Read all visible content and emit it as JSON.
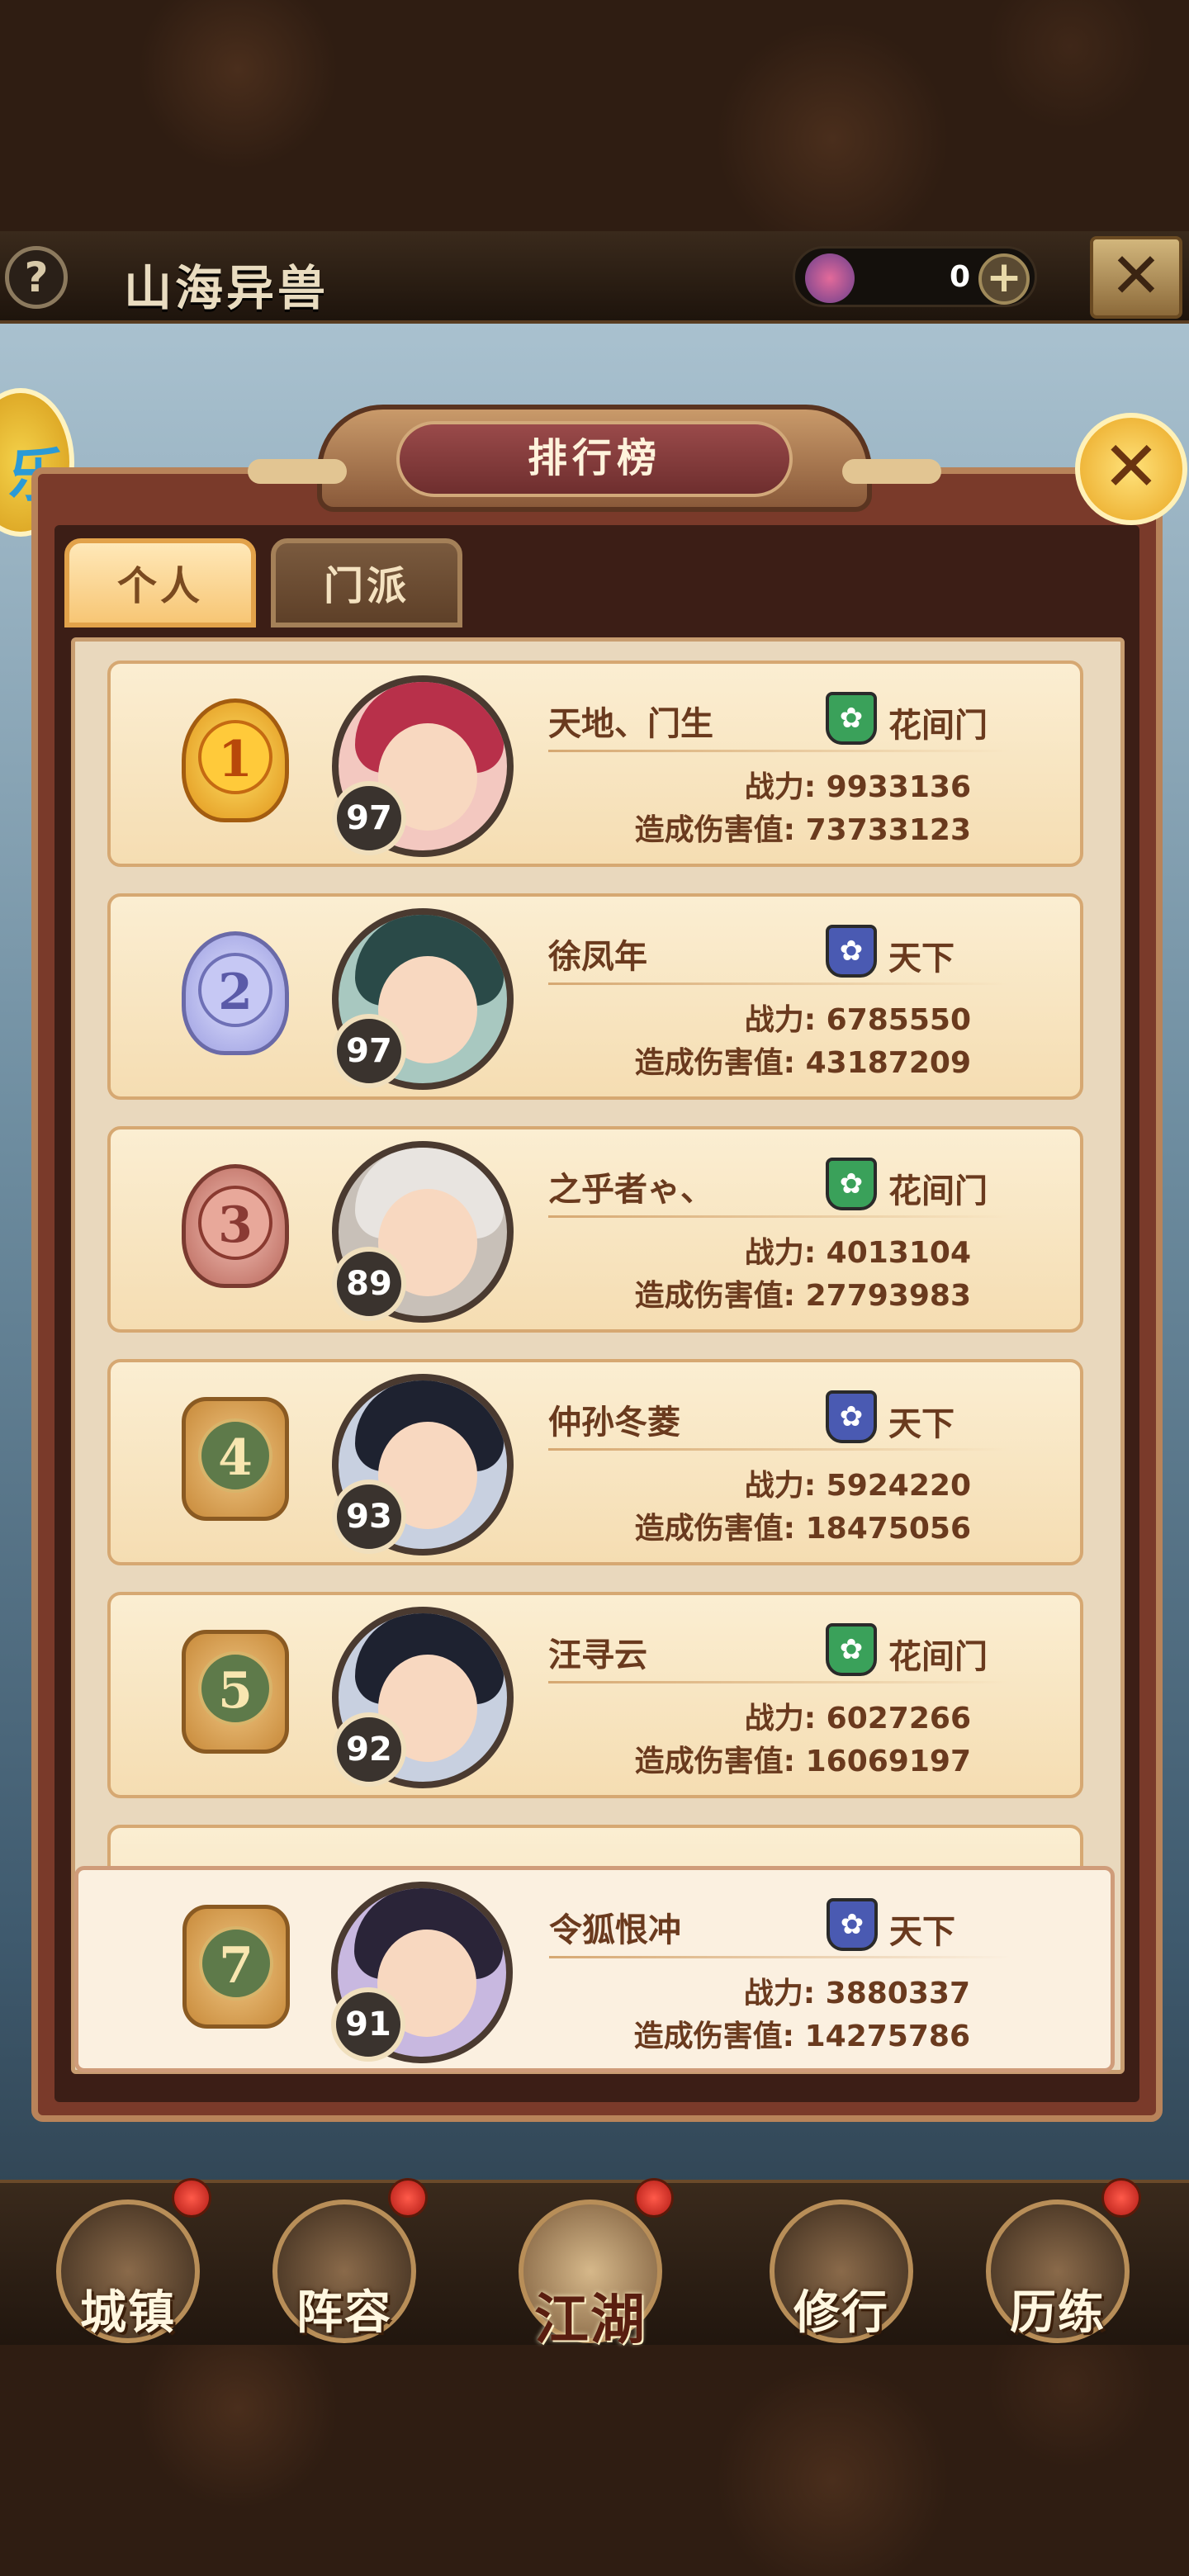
{
  "top_bar": {
    "help_label": "?",
    "scene_title": "山海异兽",
    "currency_value": "0",
    "add_label": "+",
    "close_label": "✕"
  },
  "panel": {
    "title": "排行榜",
    "close_label": "✕",
    "tabs": [
      {
        "label": "个人",
        "active": true
      },
      {
        "label": "门派",
        "active": false
      }
    ]
  },
  "rankings": [
    {
      "rank": "1",
      "level": "97",
      "name": "天地、门生",
      "faction": "花间门",
      "faction_color": "green",
      "power_label": "战力: 9933136",
      "damage_label": "造成伤害值: 73733123"
    },
    {
      "rank": "2",
      "level": "97",
      "name": "徐凤年",
      "faction": "天下",
      "faction_color": "blue",
      "power_label": "战力: 6785550",
      "damage_label": "造成伤害值: 43187209"
    },
    {
      "rank": "3",
      "level": "89",
      "name": "之乎者ゃ、",
      "faction": "花间门",
      "faction_color": "green",
      "power_label": "战力: 4013104",
      "damage_label": "造成伤害值: 27793983"
    },
    {
      "rank": "4",
      "level": "93",
      "name": "仲孙冬菱",
      "faction": "天下",
      "faction_color": "blue",
      "power_label": "战力: 5924220",
      "damage_label": "造成伤害值: 18475056"
    },
    {
      "rank": "5",
      "level": "92",
      "name": "汪寻云",
      "faction": "花间门",
      "faction_color": "green",
      "power_label": "战力: 6027266",
      "damage_label": "造成伤害值: 16069197"
    }
  ],
  "self_rank": {
    "rank": "7",
    "level": "91",
    "name": "令狐恨冲",
    "faction": "天下",
    "faction_color": "blue",
    "power_label": "战力: 3880337",
    "damage_label": "造成伤害值: 14275786"
  },
  "bottom_nav": [
    {
      "label": "城镇"
    },
    {
      "label": "阵容"
    },
    {
      "label": "江湖"
    },
    {
      "label": "修行"
    },
    {
      "label": "历练"
    }
  ],
  "colors": {
    "panel_border": "#b8835a",
    "row_bg": "#fbeed2",
    "text_brown": "#6a3a1e",
    "faction_green": "#3aa15a",
    "faction_blue": "#4a5ab2"
  }
}
